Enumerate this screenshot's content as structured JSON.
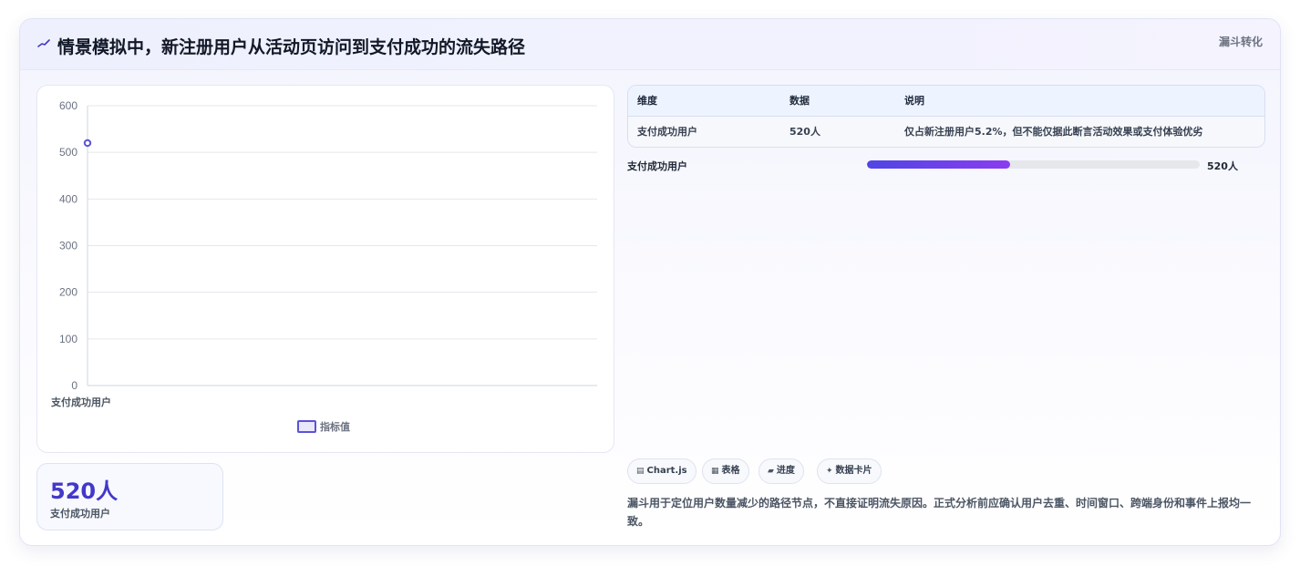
{
  "header": {
    "title": "情景模拟中，新注册用户从活动页访问到支付成功的流失路径",
    "tag": "漏斗转化",
    "icon": "trend-line-icon",
    "accent": "#4338ca"
  },
  "chart_data": {
    "type": "line",
    "categories": [
      "支付成功用户"
    ],
    "series": [
      {
        "name": "指标值",
        "values": [
          520
        ],
        "color": "#5b52d6"
      }
    ],
    "title": "",
    "xlabel": "",
    "ylabel": "",
    "ylim": [
      0,
      600
    ],
    "yticks": [
      0,
      100,
      200,
      300,
      400,
      500,
      600
    ],
    "grid": true,
    "legend": "bottom-center"
  },
  "stat": {
    "value": "520人",
    "label": "支付成功用户"
  },
  "table": {
    "headers": [
      "维度",
      "数据",
      "说明"
    ],
    "rows": [
      [
        "支付成功用户",
        "520人",
        "仅占新注册用户5.2%，但不能仅据此断言活动效果或支付体验优劣"
      ]
    ]
  },
  "progress": {
    "label": "支付成功用户",
    "value": "520人",
    "fraction": 0.43
  },
  "chips": [
    {
      "icon": "▤",
      "label": "Chart.js"
    },
    {
      "icon": "▦",
      "label": "表格"
    },
    {
      "icon": "▰",
      "label": "进度"
    },
    {
      "icon": "✦",
      "label": "数据卡片"
    }
  ],
  "note": "漏斗用于定位用户数量减少的路径节点，不直接证明流失原因。正式分析前应确认用户去重、时间窗口、跨端身份和事件上报均一致。"
}
